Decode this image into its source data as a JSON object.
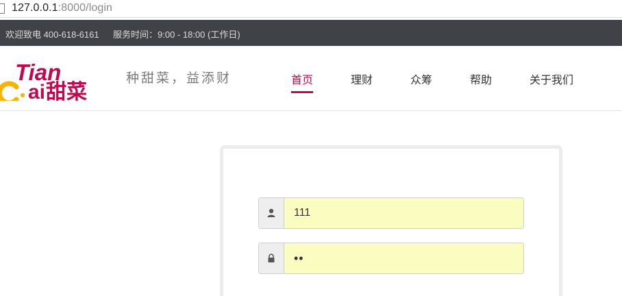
{
  "browser": {
    "url_host": "127.0.0.1",
    "url_rest": ":8000/login"
  },
  "topbar": {
    "phone": "欢迎致电 400-618-6161",
    "hours": "服务时间：9:00 - 18:00 (工作日)"
  },
  "header": {
    "logo_text_latin": "Tian Cai",
    "logo_text_cn": "甜菜",
    "slogan": "种甜菜，益添财",
    "nav": [
      {
        "label": "首页",
        "active": true
      },
      {
        "label": "理财",
        "active": false
      },
      {
        "label": "众筹",
        "active": false
      },
      {
        "label": "帮助",
        "active": false
      },
      {
        "label": "关于我们",
        "active": false
      }
    ]
  },
  "login": {
    "username_value": "111",
    "password_value": "••"
  },
  "colors": {
    "brand": "#c0094e",
    "logo_yellow": "#f4b400",
    "topbar_bg": "#3f4347",
    "autofill_bg": "#fafcc0"
  },
  "icons": {
    "user": "user-icon",
    "lock": "lock-icon"
  }
}
